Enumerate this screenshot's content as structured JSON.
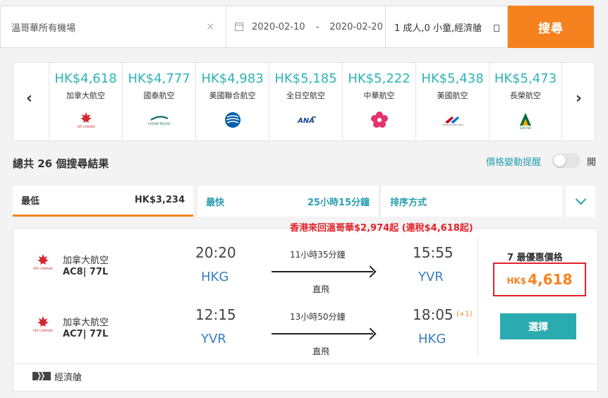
{
  "search": {
    "destination": "溫哥華所有機場",
    "clear_icon": "×",
    "depart_date": "2020-02-10",
    "date_separator": "-",
    "return_date": "2020-02-20",
    "passengers": "1 成人,0 小童,經濟艙",
    "search_label": "搜尋"
  },
  "airlines": [
    {
      "price": "HK$4,618",
      "name": "加拿大航空",
      "logo": "air-canada-logo"
    },
    {
      "price": "HK$4,777",
      "name": "國泰航空",
      "logo": "cathay-pacific-logo"
    },
    {
      "price": "HK$4,983",
      "name": "美國聯合航空",
      "logo": "united-logo"
    },
    {
      "price": "HK$5,185",
      "name": "全日空航空",
      "logo": "ana-logo"
    },
    {
      "price": "HK$5,222",
      "name": "中華航空",
      "logo": "china-airlines-logo"
    },
    {
      "price": "HK$5,438",
      "name": "美國航空",
      "logo": "american-airlines-logo"
    },
    {
      "price": "HK$5,473",
      "name": "長榮航空",
      "logo": "eva-air-logo"
    }
  ],
  "results": {
    "total": "總共 26 個搜尋結果",
    "alert_label": "價格變動提醒",
    "alert_state": "開"
  },
  "tabs": {
    "cheapest_label": "最低",
    "cheapest_value": "HK$3,234",
    "fastest_label": "最快",
    "fastest_value": "25小時15分鐘",
    "sort_label": "排序方式"
  },
  "card": {
    "promo": "香港來回溫哥華$2,974起 (連稅$4,618起)",
    "outbound": {
      "airline": "加拿大航空",
      "code": "AC8| 77L",
      "dep_time": "20:20",
      "dep_airport": "HKG",
      "duration": "11小時35分鐘",
      "stops": "直飛",
      "arr_time": "15:55",
      "arr_airport": "YVR"
    },
    "return": {
      "airline": "加拿大航空",
      "code": "AC7| 77L",
      "dep_time": "12:15",
      "dep_airport": "YVR",
      "duration": "13小時50分鐘",
      "stops": "直飛",
      "arr_time": "18:05",
      "arr_airport": "HKG",
      "day_offset": "(+1)"
    },
    "best_price_label": "7 最優惠價格",
    "price_currency": "HK$",
    "price_value": "4,618",
    "select_label": "選擇",
    "cabin": "經濟艙"
  },
  "colors": {
    "accent_orange": "#f5821f",
    "teal": "#2eb3b6",
    "promo_red": "#e3222a"
  }
}
